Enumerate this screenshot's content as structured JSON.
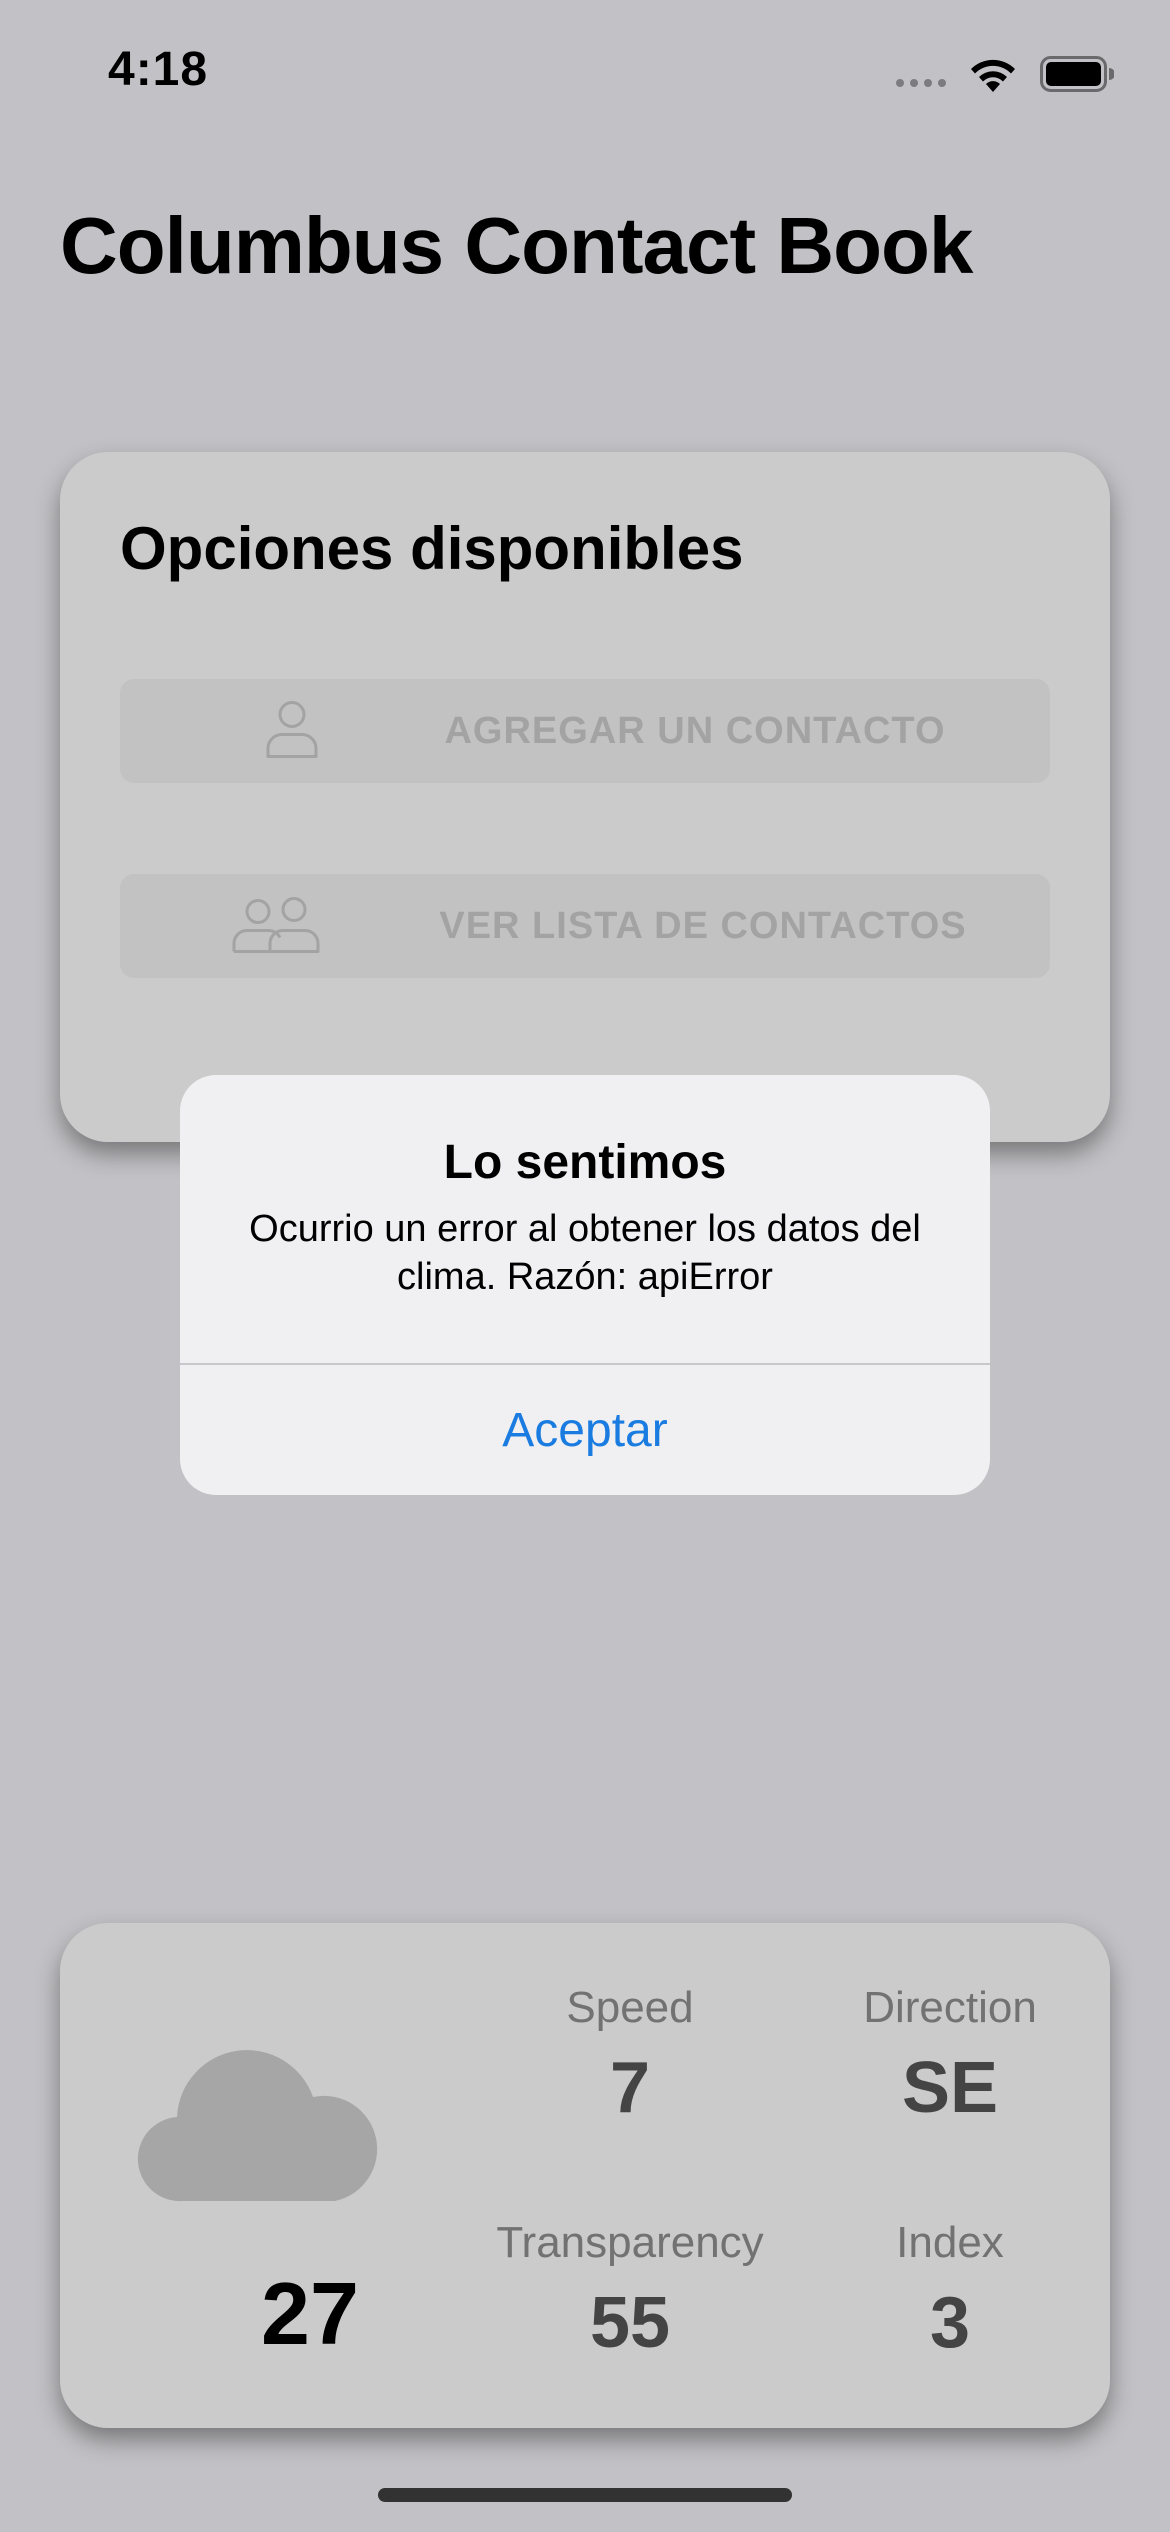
{
  "status_bar": {
    "time": "4:18"
  },
  "title": "Columbus Contact Book",
  "options_card": {
    "heading": "Opciones disponibles",
    "buttons": [
      {
        "label": "AGREGAR UN CONTACTO",
        "icon": "person-icon",
        "enabled": false
      },
      {
        "label": "VER LISTA DE CONTACTOS",
        "icon": "people-icon",
        "enabled": false
      }
    ]
  },
  "alert": {
    "title": "Lo sentimos",
    "message": "Ocurrio un error al obtener los datos del clima. Razón: apiError",
    "button": "Aceptar"
  },
  "weather": {
    "icon": "cloud-icon",
    "temperature": "27",
    "metrics": [
      {
        "label": "Speed",
        "value": "7"
      },
      {
        "label": "Direction",
        "value": "SE"
      },
      {
        "label": "Transparency",
        "value": "55"
      },
      {
        "label": "Index",
        "value": "3"
      }
    ]
  },
  "colors": {
    "background": "#c2c2c6",
    "card": "#cbcbcb",
    "alert_background": "#f0f0f2",
    "link_blue": "#1a7ce0",
    "disabled_text": "#a3a3a3"
  }
}
